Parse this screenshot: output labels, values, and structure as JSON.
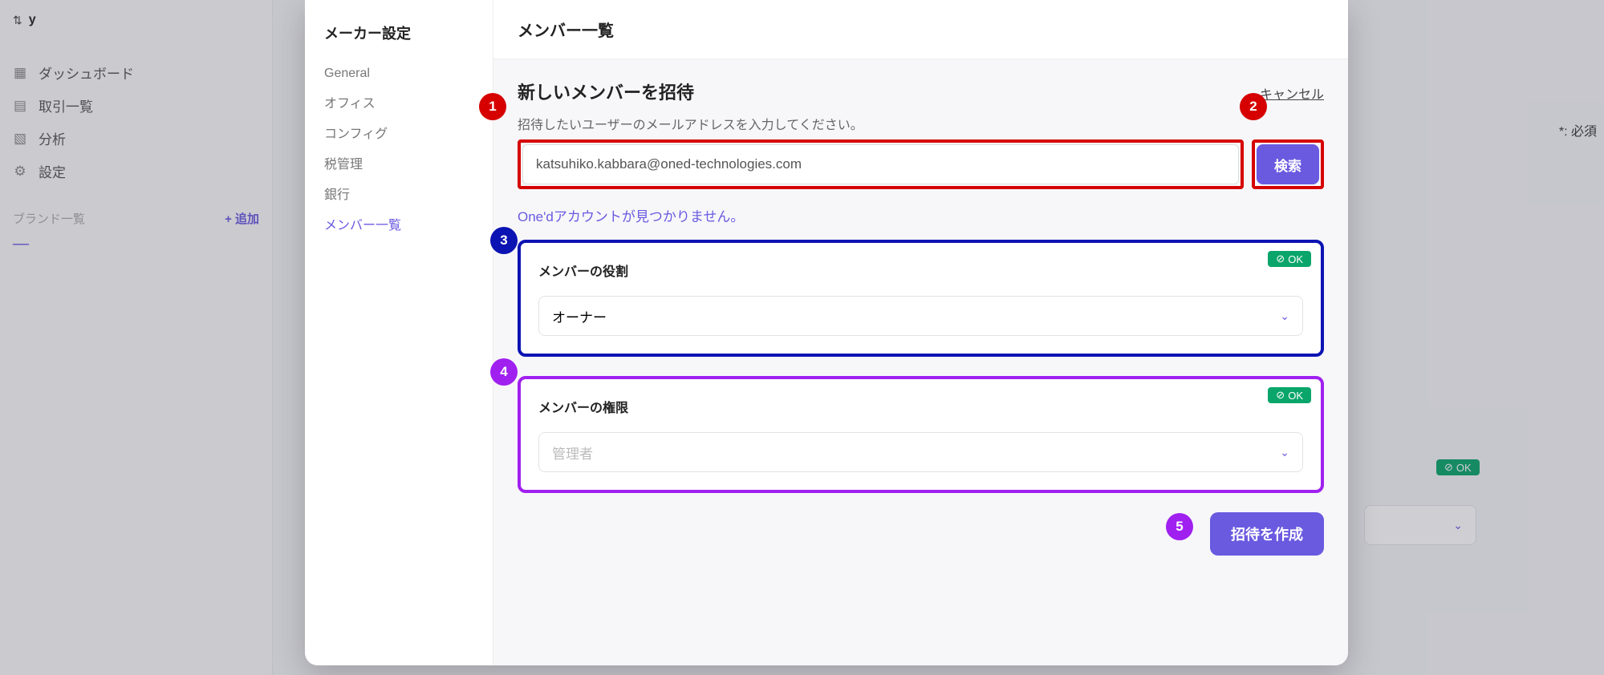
{
  "app": {
    "logo_letter": "y"
  },
  "bg_nav": {
    "items": [
      {
        "label": "ダッシュボード"
      },
      {
        "label": "取引一覧"
      },
      {
        "label": "分析"
      },
      {
        "label": "設定"
      }
    ],
    "brand_section_label": "ブランド一覧",
    "brand_add": "+ 追加",
    "brand_dash": "—"
  },
  "bg_right": {
    "required": "*: 必須",
    "ok": "OK"
  },
  "modal": {
    "sidebar": {
      "title": "メーカー設定",
      "items": [
        {
          "label": "General"
        },
        {
          "label": "オフィス"
        },
        {
          "label": "コンフィグ"
        },
        {
          "label": "税管理"
        },
        {
          "label": "銀行"
        },
        {
          "label": "メンバー一覧"
        }
      ]
    },
    "header": "メンバー一覧",
    "invite": {
      "title": "新しいメンバーを招待",
      "cancel": "キャンセル",
      "subtitle": "招待したいユーザーのメールアドレスを入力してください。",
      "email_value": "katsuhiko.kabbara@oned-technologies.com",
      "search_label": "検索",
      "not_found": "One'dアカウントが見つかりません。"
    },
    "role": {
      "label": "メンバーの役割",
      "ok": "OK",
      "selected": "オーナー"
    },
    "perm": {
      "label": "メンバーの権限",
      "ok": "OK",
      "selected": "管理者"
    },
    "submit": "招待を作成"
  },
  "markers": {
    "1": "1",
    "2": "2",
    "3": "3",
    "4": "4",
    "5": "5"
  }
}
